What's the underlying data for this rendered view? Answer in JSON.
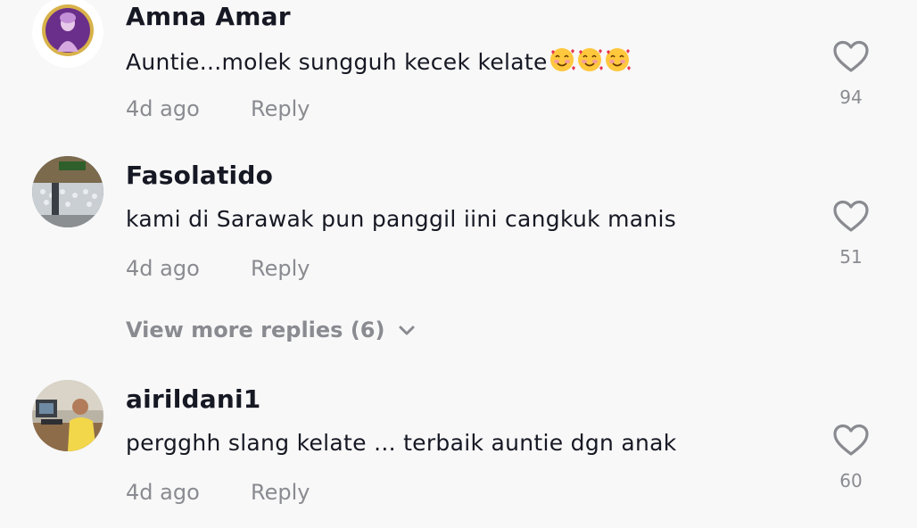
{
  "comments": [
    {
      "username": "Amna Amar",
      "text": "Auntie...molek sungguh kecek kelate",
      "emoji": [
        "smiling-face-with-hearts",
        "smiling-face-with-hearts",
        "smiling-face-with-hearts"
      ],
      "time": "4d ago",
      "reply_label": "Reply",
      "likes": "94"
    },
    {
      "username": "Fasolatido",
      "text": "kami di Sarawak pun panggil iini cangkuk manis",
      "time": "4d ago",
      "reply_label": "Reply",
      "likes": "51"
    },
    {
      "username": "airildani1",
      "text": "pergghh slang kelate ... terbaik auntie dgn anak",
      "time": "4d ago",
      "reply_label": "Reply",
      "likes": "60"
    }
  ],
  "view_more_replies": "View more replies (6)",
  "colors": {
    "background": "#f8f8f8",
    "primary_text": "#161823",
    "secondary_text": "#8a8b91"
  }
}
